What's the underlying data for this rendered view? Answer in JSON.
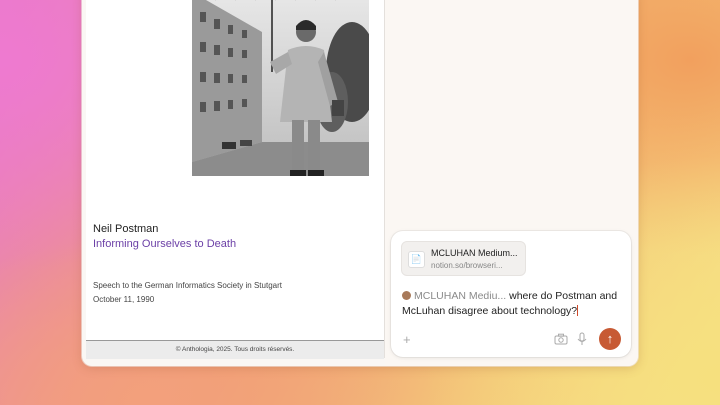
{
  "document": {
    "author": "Neil Postman",
    "title": "Informing Ourselves to Death",
    "venue": "Speech to the German Informatics Society in Stutgart",
    "date": "October 11, 1990",
    "footer": "© Anthologia, 2025. Tous droits réservés."
  },
  "chat": {
    "attachment": {
      "title": "MCLUHAN Medium...",
      "url": "notion.so/browseri..."
    },
    "prompt": {
      "chip_label": "MCLUHAN Mediu...",
      "text": " where do Postman and McLuhan disagree about technology?"
    },
    "icons": {
      "add": "plus-icon",
      "camera": "camera-icon",
      "mic": "mic-icon",
      "send": "arrow-up-icon"
    },
    "colors": {
      "send": "#c75a34",
      "title_link": "#6b3fa6"
    }
  }
}
